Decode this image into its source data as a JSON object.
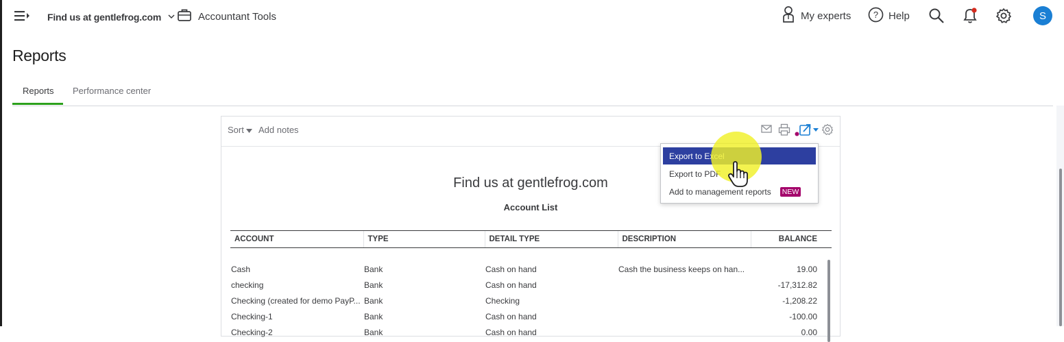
{
  "header": {
    "company_name": "Find us at gentlefrog.com",
    "accountant_tools": "Accountant Tools",
    "my_experts": "My experts",
    "help": "Help",
    "avatar_initial": "S"
  },
  "page": {
    "title": "Reports",
    "tabs": [
      {
        "label": "Reports",
        "active": true
      },
      {
        "label": "Performance center",
        "active": false
      }
    ]
  },
  "toolbar": {
    "sort_label": "Sort",
    "add_notes_label": "Add notes"
  },
  "report": {
    "company": "Find us at gentlefrog.com",
    "name": "Account List",
    "columns": [
      "ACCOUNT",
      "TYPE",
      "DETAIL TYPE",
      "DESCRIPTION",
      "BALANCE"
    ],
    "rows": [
      [
        "Cash",
        "Bank",
        "Cash on hand",
        "Cash the business keeps on han...",
        "19.00"
      ],
      [
        "checking",
        "Bank",
        "Cash on hand",
        "",
        "-17,312.82"
      ],
      [
        "Checking (created for demo PayP...",
        "Bank",
        "Checking",
        "",
        "-1,208.22"
      ],
      [
        "Checking-1",
        "Bank",
        "Cash on hand",
        "",
        "-100.00"
      ],
      [
        "Checking-2",
        "Bank",
        "Cash on hand",
        "",
        "0.00"
      ]
    ]
  },
  "export_menu": {
    "items": [
      {
        "label": "Export to Excel",
        "selected": true
      },
      {
        "label": "Export to PDF",
        "selected": false
      },
      {
        "label": "Add to management reports",
        "selected": false,
        "badge": "NEW"
      }
    ]
  },
  "colors": {
    "accent_green": "#2ca01c",
    "menu_selected": "#2d3fa0",
    "badge_new": "#a4056b",
    "avatar": "#1a7fd4",
    "notification_dot": "#d52b1e"
  }
}
